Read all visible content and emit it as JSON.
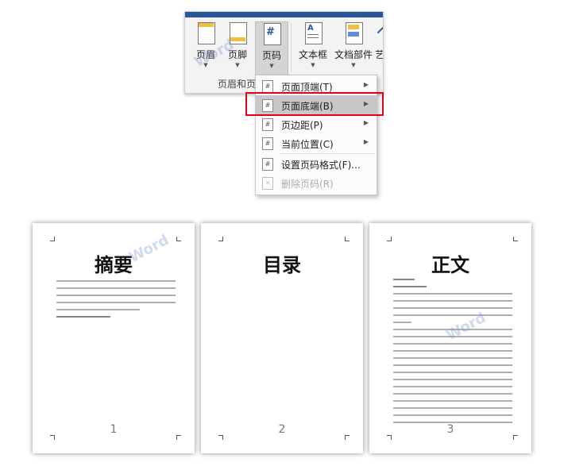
{
  "ribbon": {
    "buttons": [
      {
        "label": "页眉",
        "icon": "header-icon"
      },
      {
        "label": "页脚",
        "icon": "footer-icon"
      },
      {
        "label": "页码",
        "icon": "page-number-icon",
        "active": true
      },
      {
        "label": "文本框",
        "icon": "text-box-icon"
      },
      {
        "label": "文档部件",
        "icon": "quick-parts-icon"
      },
      {
        "label": "艺",
        "icon": "wordart-icon"
      }
    ],
    "group_label": "页眉和页",
    "accent": "#2b579a"
  },
  "menu": {
    "items": [
      {
        "label": "页面顶端(T)",
        "submenu": true,
        "icon": "page-top-icon"
      },
      {
        "label": "页面底端(B)",
        "submenu": true,
        "icon": "page-bottom-icon",
        "highlighted": true
      },
      {
        "label": "页边距(P)",
        "submenu": true,
        "icon": "page-margin-icon"
      },
      {
        "label": "当前位置(C)",
        "submenu": true,
        "icon": "current-position-icon"
      },
      {
        "label": "设置页码格式(F)...",
        "submenu": false,
        "icon": "format-page-number-icon"
      },
      {
        "label": "删除页码(R)",
        "submenu": false,
        "icon": "remove-page-number-icon",
        "disabled": true
      }
    ],
    "highlight_color": "#e3001b"
  },
  "pages": [
    {
      "title": "摘要",
      "number": "1"
    },
    {
      "title": "目录",
      "number": "2"
    },
    {
      "title": "正文",
      "number": "3"
    }
  ],
  "watermark": "Word"
}
